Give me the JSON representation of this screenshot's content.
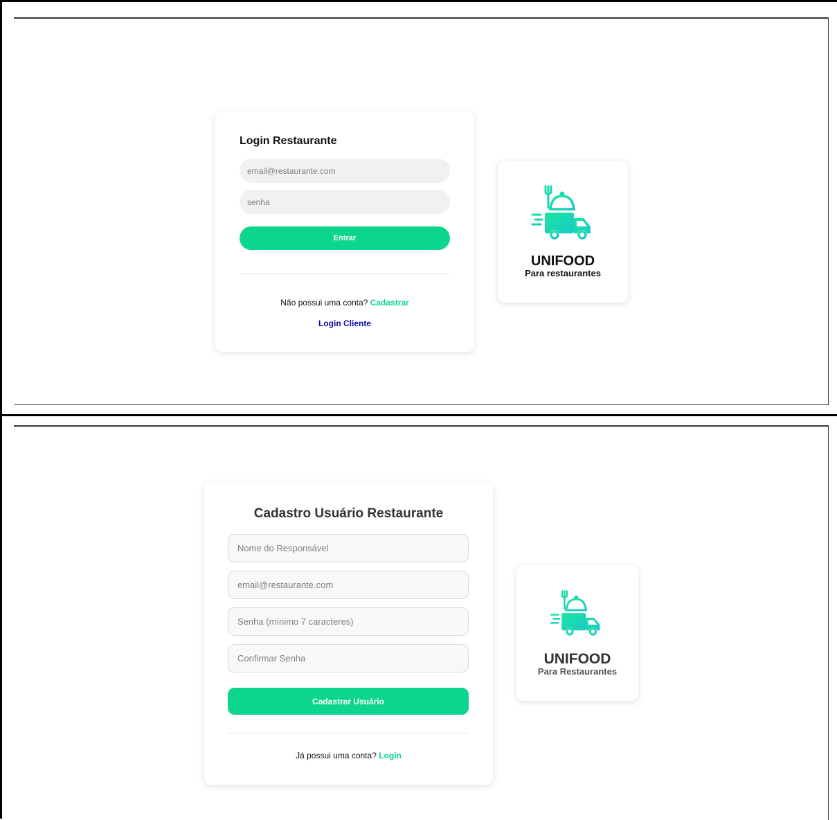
{
  "login": {
    "title": "Login Restaurante",
    "email_placeholder": "email@restaurante.com",
    "password_placeholder": "senha",
    "submit_label": "Entrar",
    "no_account_text": "Não possui uma conta?",
    "register_link": "Cadastrar",
    "client_login_link": "Login Cliente"
  },
  "brand_top": {
    "icon": "food-delivery-truck-icon",
    "name": "UNIFOOD",
    "subtitle": "Para restaurantes"
  },
  "register": {
    "title": "Cadastro Usuário Restaurante",
    "name_placeholder": "Nome do Responsável",
    "email_placeholder": "email@restaurante.com",
    "password_placeholder": "Senha (mínimo 7 caracteres)",
    "confirm_placeholder": "Confirmar Senha",
    "submit_label": "Cadastrar Usuário",
    "has_account_text": "Já possui uma conta?",
    "login_link": "Login"
  },
  "brand_bottom": {
    "icon": "food-delivery-truck-icon",
    "name": "UNIFOOD",
    "subtitle": "Para Restaurantes"
  },
  "colors": {
    "accent": "#0bd68c",
    "accent_gradient_start": "#19e6a0",
    "accent_gradient_end": "#1bc8c8",
    "client_link": "#0a0aa8"
  }
}
